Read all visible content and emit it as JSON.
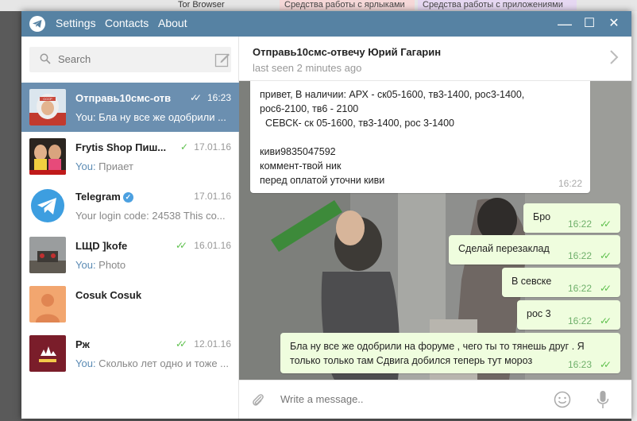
{
  "background": {
    "tabs": [
      "Tor Browser",
      "Средства работы с ярлыками",
      "Средства работы с приложениями"
    ]
  },
  "window": {
    "menu": [
      "Settings",
      "Contacts",
      "About"
    ],
    "controls": {
      "minimize": "—",
      "maximize": "☐",
      "close": "✕"
    }
  },
  "search": {
    "placeholder": "Search"
  },
  "dialogs": [
    {
      "name": "Отправь10смс-отве...",
      "time": "16:23",
      "you": "You:",
      "text": " Бла ну все же одобрили ...",
      "read": true
    },
    {
      "name": "Frytis Shop Пиш...",
      "time": "17.01.16",
      "you": "You:",
      "text": " Приает",
      "read": true
    },
    {
      "name": "Telegram",
      "time": "17.01.16",
      "you": "",
      "text": "Your login code: 24538  This co...",
      "read": false
    },
    {
      "name": "LЩD ]kofe",
      "time": "16.01.16",
      "you": "You:",
      "text": " Photo",
      "read": true
    },
    {
      "name": "Cosuk Cosuk",
      "time": "",
      "you": "",
      "text": "",
      "read": false
    },
    {
      "name": "Рж",
      "time": "12.01.16",
      "you": "You:",
      "text": " Сколько лет одно и тоже ...",
      "read": true
    }
  ],
  "chat": {
    "title": "Отправь10смс-отвечу Юрий Гагарин",
    "status": "last seen 2 minutes ago",
    "incoming": {
      "text": "привет, В наличии: АРХ - ск05-1600, тв3-1400, рос3-1400,\nрос6-2100, тв6 - 2100\n  СЕВСК- ск 05-1600, тв3-1400, рос 3-1400\n\nкиви9835047592\nкоммент-твой ник\nперед оплатой уточни киви",
      "time": "16:22"
    },
    "outgoing": [
      {
        "text": "Бро",
        "time": "16:22"
      },
      {
        "text": "Сделай перезаклад",
        "time": "16:22"
      },
      {
        "text": "В севске",
        "time": "16:22"
      },
      {
        "text": "рос 3",
        "time": "16:22"
      },
      {
        "text": "Бла ну все же одобрили на форуме , чего ты то тянешь друг . Я\nтолько только там Сдвига добился теперь тут мороз",
        "time": "16:23"
      }
    ]
  },
  "composer": {
    "placeholder": "Write a message.."
  },
  "colors": {
    "titlebar": "#5682a3",
    "active_dialog": "#6b8fb0",
    "outgoing_bubble": "#effdde",
    "check": "#5ec04d"
  }
}
